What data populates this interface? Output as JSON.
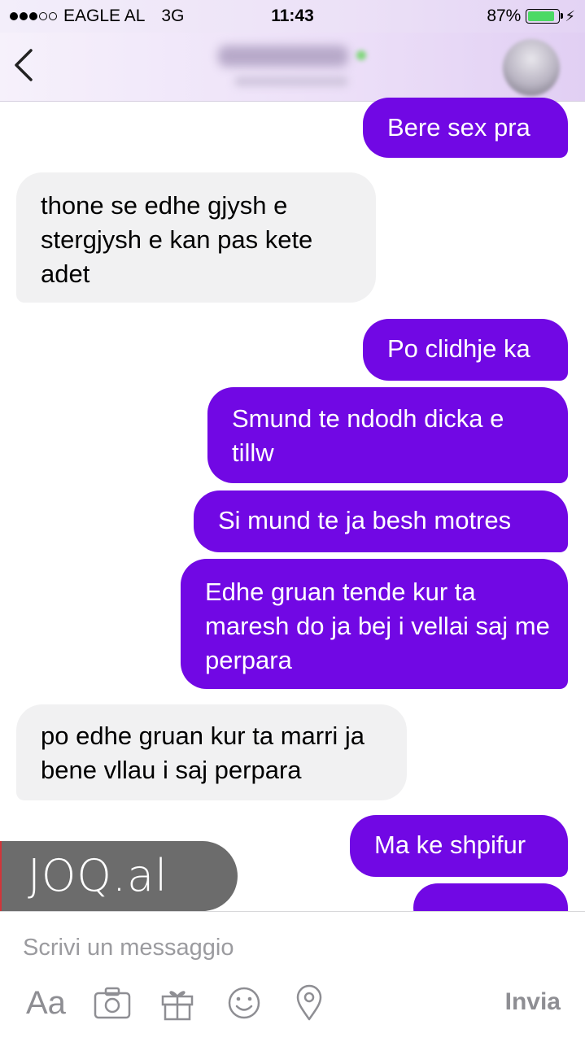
{
  "status_bar": {
    "carrier": "EAGLE AL",
    "network": "3G",
    "time": "11:43",
    "battery": "87%",
    "battery_level": 0.87,
    "signal_bars_filled": 3,
    "signal_bars_total": 5
  },
  "header": {
    "back_icon": "chevron-left-icon"
  },
  "messages": [
    {
      "direction": "out",
      "text": "Bere sex pra"
    },
    {
      "direction": "in",
      "text": "thone se edhe gjysh e stergjysh e kan pas kete adet"
    },
    {
      "direction": "out",
      "text": "Po clidhje ka"
    },
    {
      "direction": "out",
      "text": "Smund te ndodh dicka e tillw"
    },
    {
      "direction": "out",
      "text": "Si mund te ja besh motres"
    },
    {
      "direction": "out",
      "text": "Edhe gruan tende kur ta maresh do ja bej i vellai saj me perpara"
    },
    {
      "direction": "in",
      "text": "po edhe gruan kur ta marri ja bene vllau i saj perpara"
    },
    {
      "direction": "out",
      "text": "Ma ke shpifur"
    }
  ],
  "watermark": {
    "text": "JOQ.al"
  },
  "composer": {
    "placeholder": "Scrivi un messaggio",
    "value": "",
    "text_format_label": "Aa",
    "send_label": "Invia",
    "icons": [
      "text-format-icon",
      "camera-icon",
      "gift-icon",
      "emoji-icon",
      "location-pin-icon"
    ]
  },
  "colors": {
    "outgoing_bubble": "#7108e4",
    "incoming_bubble": "#f1f1f2",
    "header_tint": "#ecdff8",
    "icon_gray": "#8e8e93"
  }
}
